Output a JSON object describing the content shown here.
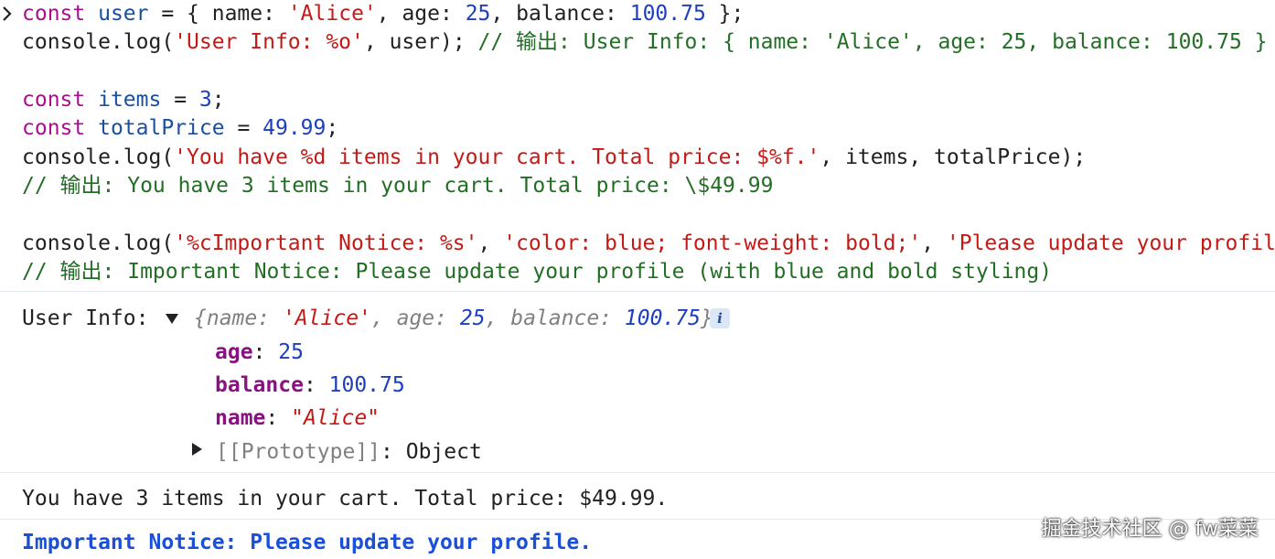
{
  "code": {
    "line1": {
      "kw": "const",
      "var": "user",
      "eq": " = { name: ",
      "str1": "'Alice'",
      "mid1": ", age: ",
      "num1": "25",
      "mid2": ", balance: ",
      "num2": "100.75",
      "end": " };"
    },
    "line2": {
      "pre": "console.log(",
      "str": "'User Info: %o'",
      "post": ", user); ",
      "comment": "// 输出: User Info: { name: 'Alice', age: 25, balance: 100.75 }"
    },
    "line4": {
      "kw": "const",
      "var": "items",
      "eq": " = ",
      "num": "3",
      "end": ";"
    },
    "line5": {
      "kw": "const",
      "var": "totalPrice",
      "eq": " = ",
      "num": "49.99",
      "end": ";"
    },
    "line6": {
      "pre": "console.log(",
      "str": "'You have %d items in your cart. Total price: $%f.'",
      "post": ", items, totalPrice);"
    },
    "line7": {
      "comment": "// 输出: You have 3 items in your cart. Total price: \\$49.99"
    },
    "line9": {
      "pre": "console.log(",
      "str1": "'%cImportant Notice: %s'",
      "sep1": ", ",
      "str2": "'color: blue; font-weight: bold;'",
      "sep2": ", ",
      "str3": "'Please update your profile.'"
    },
    "line10": {
      "comment": "// 输出: Important Notice: Please update your profile (with blue and bold styling)"
    }
  },
  "output": {
    "user_info_label": "User Info: ",
    "object_preview": {
      "open": "{",
      "k1": "name",
      "v1": "'Alice'",
      "k2": "age",
      "v2": "25",
      "k3": "balance",
      "v3": "100.75",
      "close": "}"
    },
    "info_badge": "i",
    "properties": [
      {
        "key": "age",
        "value": "25"
      },
      {
        "key": "balance",
        "value": "100.75"
      },
      {
        "key": "name",
        "value": "\"Alice\""
      }
    ],
    "prototype": {
      "key": "[[Prototype]]",
      "value": "Object"
    },
    "cart_message": "You have 3 items in your cart. Total price: $49.99.",
    "notice_message": "Important Notice: Please update your profile."
  },
  "watermark": "掘金技术社区 @ fw菜菜",
  "colors": {
    "keyword": "#aa0d91",
    "string": "#c41a16",
    "number": "#1c3fbf",
    "comment": "#236e25",
    "notice": "#1a4fd8"
  }
}
